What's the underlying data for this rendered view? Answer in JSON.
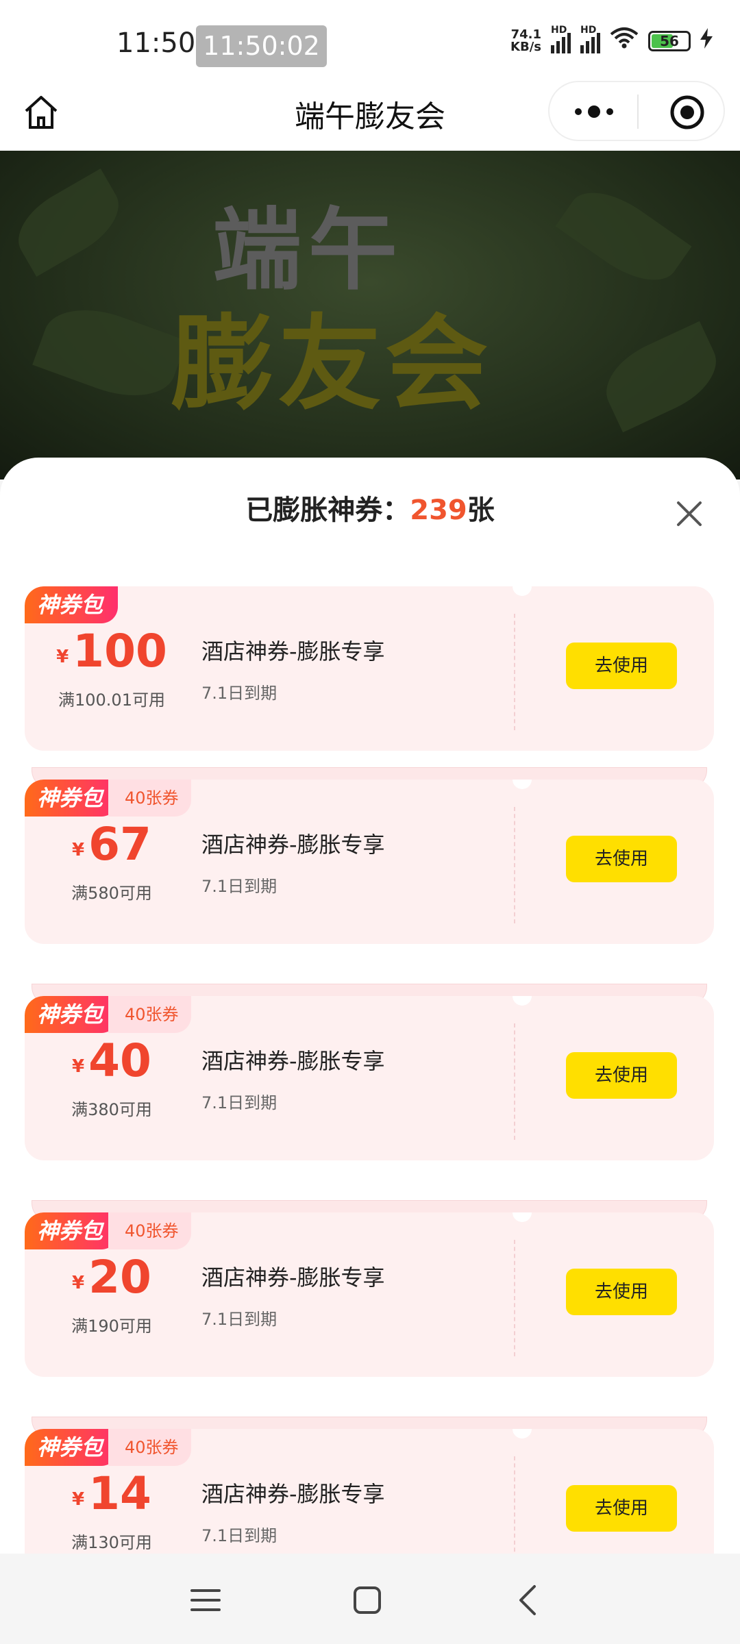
{
  "status_bar": {
    "time": "11:50",
    "time_badge": "11:50:02",
    "net_speed_top": "74.1",
    "net_speed_bottom": "KB/s",
    "signal_label": "HD",
    "battery": "56"
  },
  "nav": {
    "title": "端午膨友会"
  },
  "banner": {
    "line1": "端午",
    "line2": "膨友会"
  },
  "sheet": {
    "title_prefix": "已膨胀神券：",
    "count": "239",
    "title_suffix": "张"
  },
  "coupons": [
    {
      "tag": "神券包",
      "tag_sub": "",
      "currency": "¥",
      "amount": "100",
      "threshold": "满100.01可用",
      "name": "酒店神券-膨胀专享",
      "expiry": "7.1日到期",
      "button": "去使用"
    },
    {
      "tag": "神券包",
      "tag_sub": "40张券",
      "currency": "¥",
      "amount": "67",
      "threshold": "满580可用",
      "name": "酒店神券-膨胀专享",
      "expiry": "7.1日到期",
      "button": "去使用"
    },
    {
      "tag": "神券包",
      "tag_sub": "40张券",
      "currency": "¥",
      "amount": "40",
      "threshold": "满380可用",
      "name": "酒店神券-膨胀专享",
      "expiry": "7.1日到期",
      "button": "去使用"
    },
    {
      "tag": "神券包",
      "tag_sub": "40张券",
      "currency": "¥",
      "amount": "20",
      "threshold": "满190可用",
      "name": "酒店神券-膨胀专享",
      "expiry": "7.1日到期",
      "button": "去使用"
    },
    {
      "tag": "神券包",
      "tag_sub": "40张券",
      "currency": "¥",
      "amount": "14",
      "threshold": "满130可用",
      "name": "酒店神券-膨胀专享",
      "expiry": "7.1日到期",
      "button": "去使用"
    }
  ],
  "colors": {
    "accent": "#f0452e",
    "button": "#ffdf00",
    "coupon_bg": "#fef0f0"
  },
  "icons": [
    "home-icon",
    "more-icon",
    "target-icon",
    "close-icon",
    "menu-icon",
    "square-icon",
    "back-icon"
  ]
}
